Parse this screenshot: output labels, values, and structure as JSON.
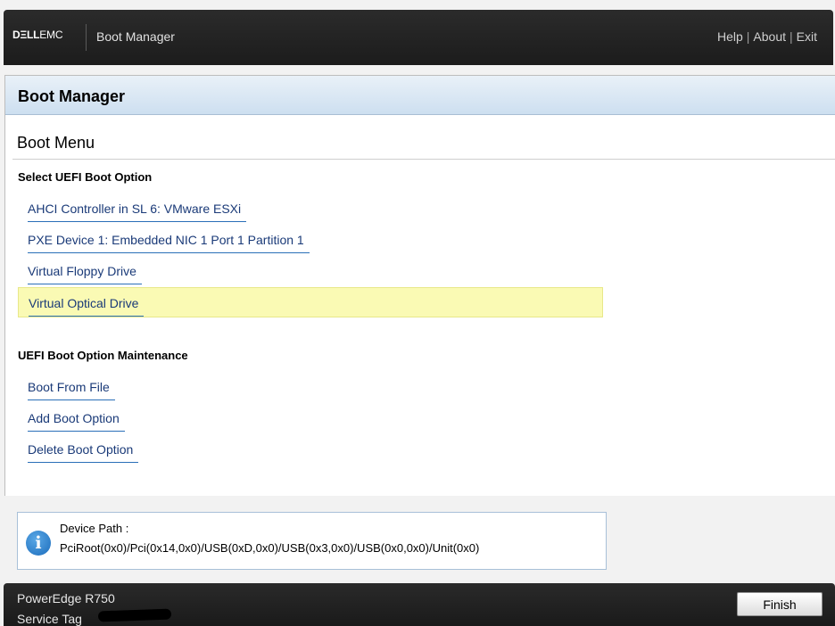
{
  "header": {
    "logo_bold": "DΞLL",
    "logo_light": "EMC",
    "title": "Boot Manager",
    "links": {
      "help": "Help",
      "about": "About",
      "exit": "Exit",
      "separator": "|"
    }
  },
  "panel": {
    "title": "Boot Manager",
    "menu_title": "Boot Menu",
    "uefi_section": {
      "heading": "Select UEFI Boot Option",
      "options": [
        {
          "label": "AHCI Controller in SL 6: VMware ESXi",
          "selected": false
        },
        {
          "label": "PXE Device 1: Embedded NIC 1 Port 1 Partition 1",
          "selected": false
        },
        {
          "label": "Virtual Floppy Drive",
          "selected": false
        },
        {
          "label": "Virtual Optical Drive",
          "selected": true
        }
      ]
    },
    "maintenance_section": {
      "heading": "UEFI Boot Option Maintenance",
      "options": [
        {
          "label": "Boot From File"
        },
        {
          "label": "Add Boot Option"
        },
        {
          "label": "Delete Boot Option"
        }
      ]
    }
  },
  "info": {
    "icon": "info-icon",
    "icon_glyph": "i",
    "label": "Device Path :",
    "value": "PciRoot(0x0)/Pci(0x14,0x0)/USB(0xD,0x0)/USB(0x3,0x0)/USB(0x0,0x0)/Unit(0x0)"
  },
  "footer": {
    "model": "PowerEdge R750",
    "service_tag_label": "Service Tag",
    "finish_label": "Finish"
  },
  "colors": {
    "selected_row": "#fafab4",
    "link_text": "#1a3a78",
    "underline": "#2a6fb8",
    "header_bar": "#222222"
  }
}
